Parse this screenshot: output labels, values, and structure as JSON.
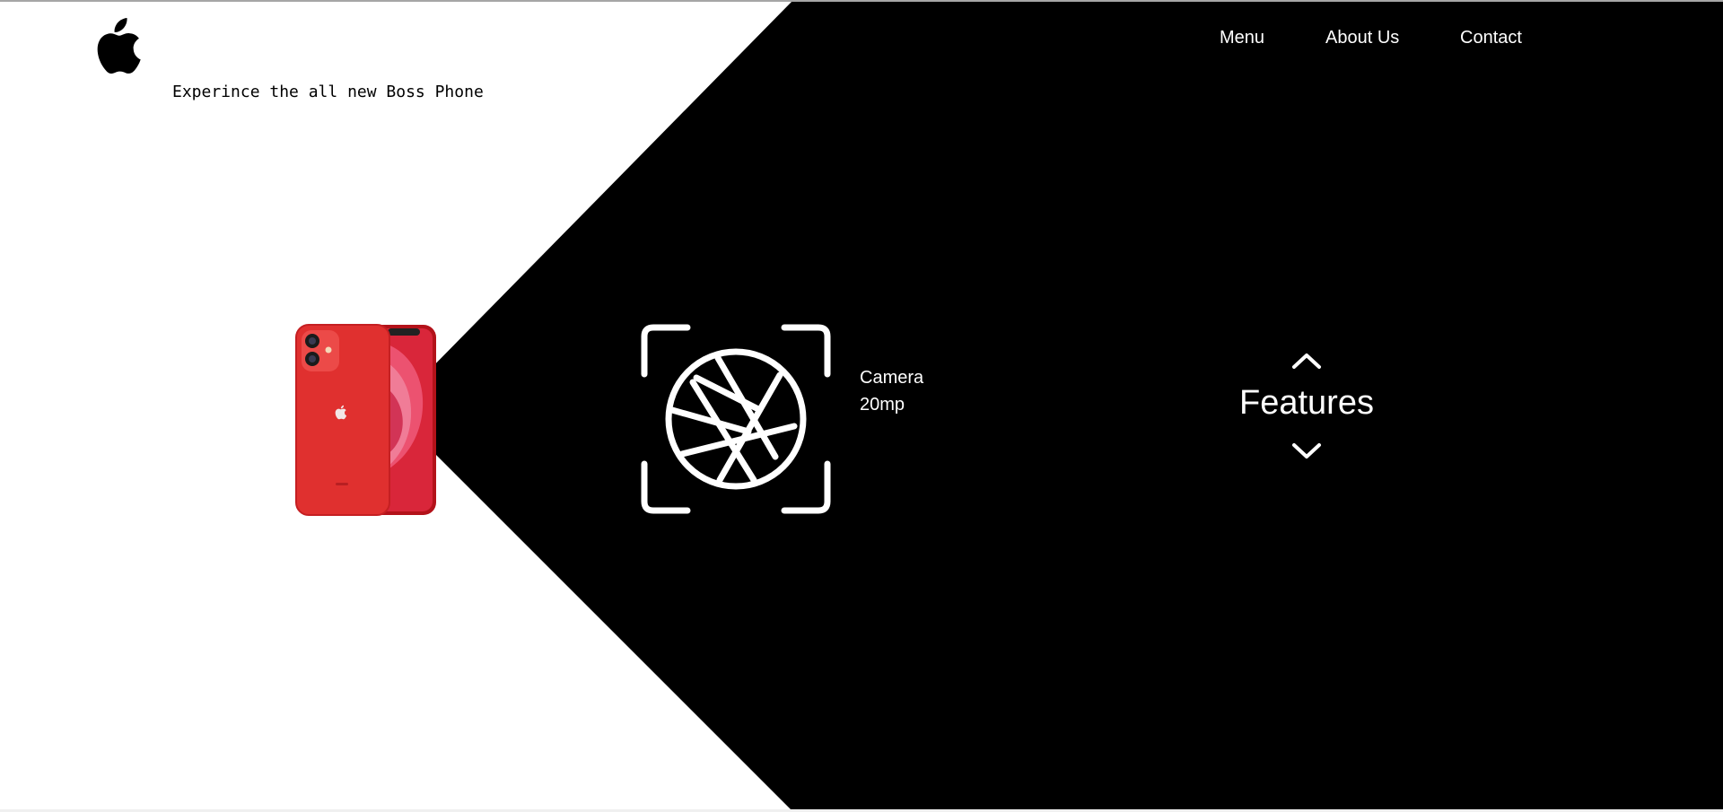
{
  "brand": {
    "logo_icon": "apple-logo-icon",
    "tagline": "Experince the all new Boss Phone"
  },
  "nav": {
    "items": [
      {
        "label": "Menu"
      },
      {
        "label": "About Us"
      },
      {
        "label": "Contact"
      }
    ]
  },
  "hero": {
    "product_image": "red-smartphone-image",
    "feature_icon": "camera-aperture-icon",
    "feature_name": "Camera",
    "feature_value": "20mp",
    "section_title": "Features",
    "prev_icon": "chevron-up-icon",
    "next_icon": "chevron-down-icon"
  },
  "colors": {
    "background_light": "#ffffff",
    "background_dark": "#000000",
    "text_light": "#ffffff",
    "text_dark": "#000000",
    "phone_red": "#e0302f"
  }
}
